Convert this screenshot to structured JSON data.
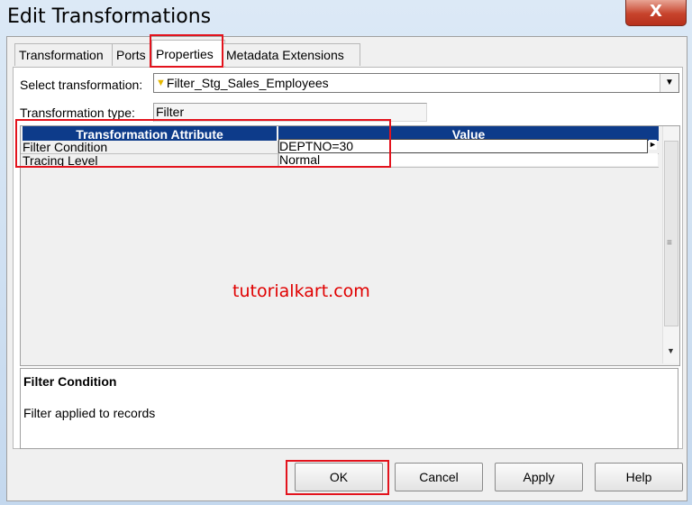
{
  "window": {
    "title": "Edit Transformations",
    "close_glyph": "X"
  },
  "tabs": [
    {
      "label": "Transformation"
    },
    {
      "label": "Ports"
    },
    {
      "label": "Properties"
    },
    {
      "label": "Metadata Extensions"
    }
  ],
  "active_tab": "Properties",
  "select_transformation": {
    "label": "Select transformation:",
    "value": "Filter_Stg_Sales_Employees",
    "icon": "filter-diamond-icon"
  },
  "transformation_type": {
    "label": "Transformation type:",
    "value": "Filter"
  },
  "grid": {
    "columns": [
      "Transformation Attribute",
      "Value"
    ],
    "rows": [
      {
        "attribute": "Filter Condition",
        "value": "DEPTNO=30"
      },
      {
        "attribute": "Tracing Level",
        "value": "Normal"
      }
    ]
  },
  "watermark": "tutorialkart.com",
  "description": {
    "title": "Filter Condition",
    "text": "Filter applied to records"
  },
  "buttons": {
    "ok": "OK",
    "cancel": "Cancel",
    "apply": "Apply",
    "help": "Help"
  },
  "colors": {
    "header_bg": "#0d3b8a",
    "highlight": "#e3131d",
    "close_button": "#c7432c"
  }
}
